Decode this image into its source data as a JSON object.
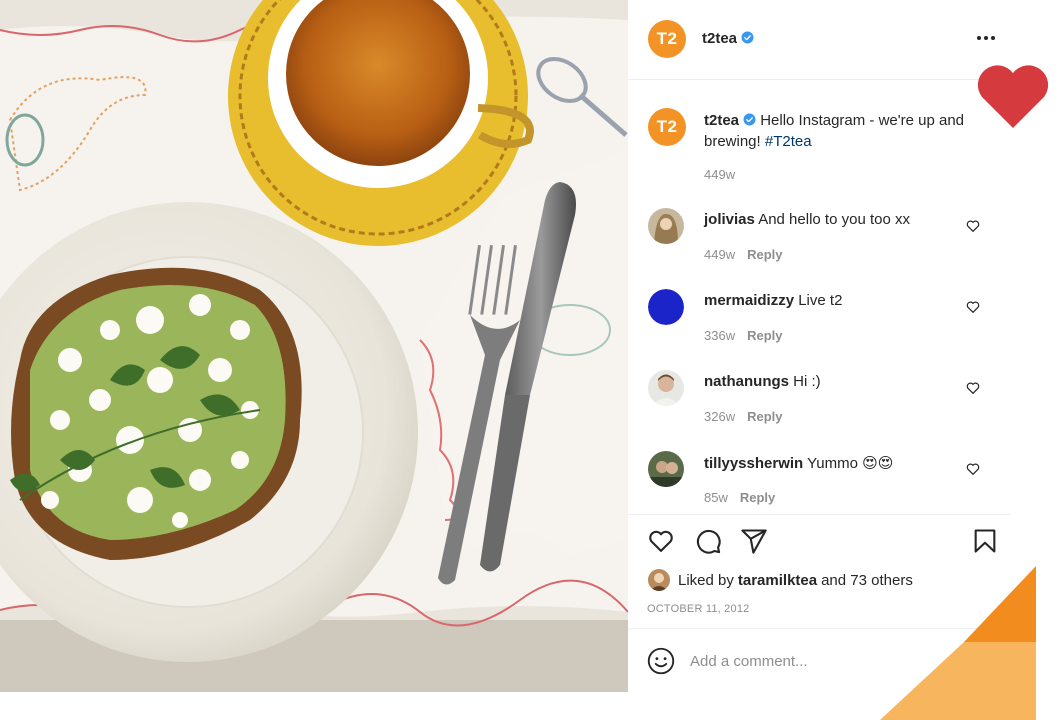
{
  "post": {
    "account": {
      "username": "t2tea",
      "avatar_text": "T2",
      "avatar_color": "#f39325",
      "verified_icon": "verified-badge-icon"
    },
    "caption": {
      "username": "t2tea",
      "text": "Hello Instagram - we're up and brewing!",
      "hashtag": "#T2tea",
      "age": "449w"
    },
    "comments": [
      {
        "username": "jolivias",
        "text": "And hello to you too xx",
        "age": "449w",
        "reply_label": "Reply"
      },
      {
        "username": "mermaidizzy",
        "text": "Live t2",
        "age": "336w",
        "reply_label": "Reply"
      },
      {
        "username": "nathanungs",
        "text": "Hi :)",
        "age": "326w",
        "reply_label": "Reply"
      },
      {
        "username": "tillyyssherwin",
        "text": "Yummo 😍😍",
        "age": "85w",
        "reply_label": "Reply"
      }
    ],
    "likes": {
      "prefix": "Liked by",
      "user": "taramilktea",
      "suffix": "and 73 others"
    },
    "date": "OCTOBER 11, 2012",
    "add_comment_placeholder": "Add a comment..."
  },
  "colors": {
    "brand_orange": "#f39325",
    "deco_heart": "#d53a3f",
    "deco_orange": "#f28c1e",
    "deco_peach": "#f7b55d",
    "link_blue": "#00376b",
    "verified_blue": "#3897f0",
    "muted_text": "#8e8e8e"
  }
}
